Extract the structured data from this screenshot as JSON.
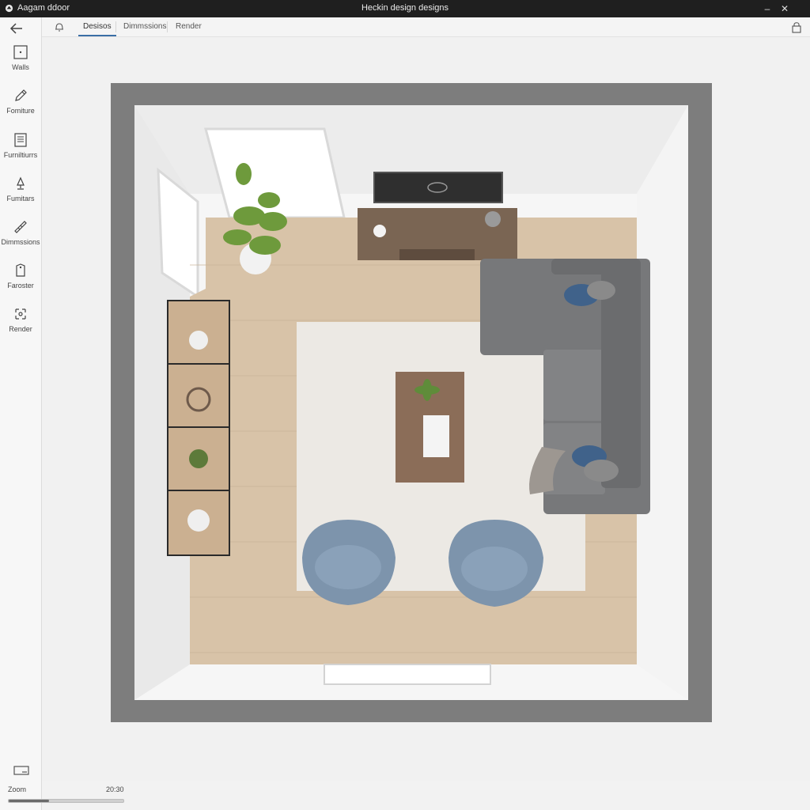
{
  "window": {
    "app_name": "Aagam ddoor",
    "title": "Heckin design designs"
  },
  "sidebar": {
    "back_icon": "arrow-left-icon",
    "items": [
      {
        "label": "Walls",
        "icon": "walls-icon"
      },
      {
        "label": "Fomiture",
        "icon": "pencil-icon"
      },
      {
        "label": "Furniltiurrs",
        "icon": "document-icon"
      },
      {
        "label": "Fumitars",
        "icon": "lamp-icon"
      },
      {
        "label": "Dimmssions",
        "icon": "ruler-icon"
      },
      {
        "label": "Faroster",
        "icon": "tag-icon"
      },
      {
        "label": "Render",
        "icon": "render-icon"
      }
    ]
  },
  "tabs": [
    {
      "label": "Desisos",
      "active": true
    },
    {
      "label": "Dimmssions",
      "active": false
    },
    {
      "label": "Render",
      "active": false
    }
  ],
  "zoom": {
    "label": "Zoom",
    "value": "20:30",
    "level": 0.35
  },
  "colors": {
    "accent": "#3a6ea5",
    "outer_wall": "#7d7d7d",
    "floor": "#d8c3a8",
    "rug": "#ece9e4",
    "sofa": "#77787a",
    "armchair": "#7d94ac",
    "tv_console": "#7a6553"
  }
}
